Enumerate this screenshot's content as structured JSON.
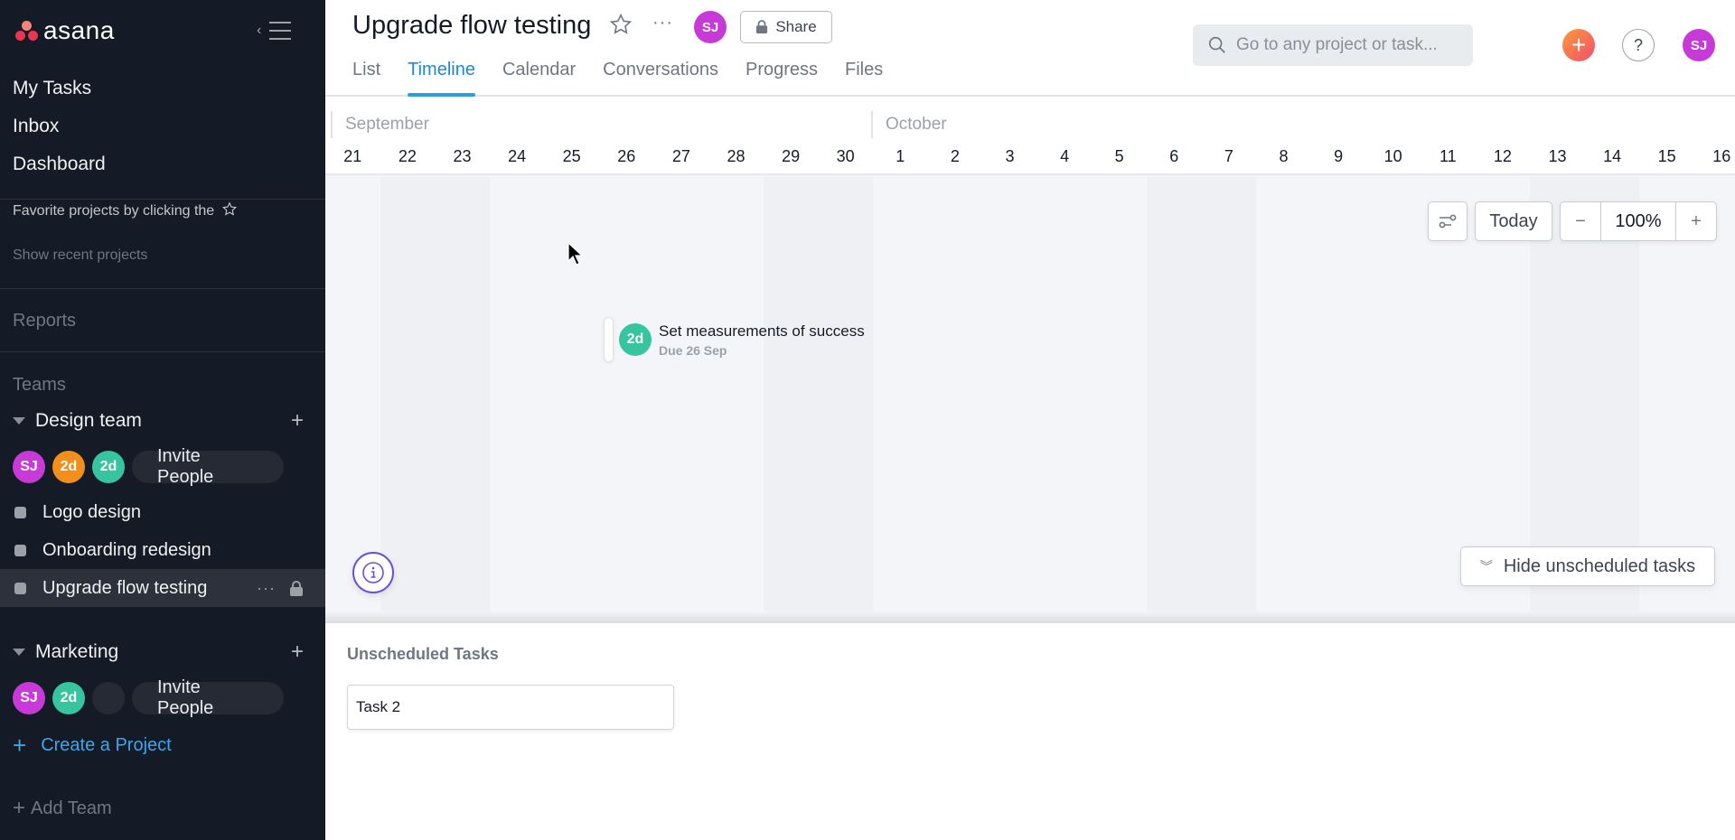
{
  "sidebar": {
    "logo": "asana",
    "nav": [
      "My Tasks",
      "Inbox",
      "Dashboard"
    ],
    "favorites_hint": "Favorite projects by clicking the",
    "show_recent": "Show recent projects",
    "reports": "Reports",
    "teams_label": "Teams",
    "teams": [
      {
        "name": "Design team",
        "members": [
          {
            "initials": "SJ",
            "color": "#c73ad8"
          },
          {
            "initials": "2d",
            "color": "#f28f1c"
          },
          {
            "initials": "2d",
            "color": "#37c5a0"
          }
        ],
        "invite_label": "Invite People",
        "projects": [
          {
            "name": "Logo design"
          },
          {
            "name": "Onboarding redesign"
          },
          {
            "name": "Upgrade flow testing",
            "active": true
          }
        ]
      },
      {
        "name": "Marketing",
        "members": [
          {
            "initials": "SJ",
            "color": "#c73ad8"
          },
          {
            "initials": "2d",
            "color": "#37c5a0"
          },
          {
            "initials": "",
            "color": "#252a35"
          }
        ],
        "invite_label": "Invite People",
        "projects": []
      }
    ],
    "create_project": "Create a Project",
    "add_team": "Add Team"
  },
  "header": {
    "project_title": "Upgrade flow testing",
    "owner_initials": "SJ",
    "share_label": "Share",
    "tabs": [
      {
        "label": "List"
      },
      {
        "label": "Timeline",
        "active": true
      },
      {
        "label": "Calendar"
      },
      {
        "label": "Conversations"
      },
      {
        "label": "Progress"
      },
      {
        "label": "Files"
      }
    ],
    "search_placeholder": "Go to any project or task...",
    "help_label": "?",
    "user_initials": "SJ"
  },
  "timeline": {
    "months": [
      {
        "label": "September",
        "start_day_index": 0
      },
      {
        "label": "October",
        "start_day_index": 10
      }
    ],
    "days": [
      "21",
      "22",
      "23",
      "24",
      "25",
      "26",
      "27",
      "28",
      "29",
      "30",
      "1",
      "2",
      "3",
      "4",
      "5",
      "6",
      "7",
      "8",
      "9",
      "10",
      "11",
      "12",
      "13",
      "14",
      "15",
      "16"
    ],
    "weekend_day_indices": [
      1,
      2,
      8,
      9,
      15,
      16,
      22,
      23
    ],
    "controls": {
      "today_label": "Today",
      "zoom_level": "100%",
      "zoom_out": "−",
      "zoom_in": "+"
    },
    "tasks": [
      {
        "name": "Set measurements of success",
        "due": "Due 26 Sep",
        "assignee_initials": "2d",
        "assignee_color": "#37c5a0",
        "day_index": 5
      }
    ],
    "hide_unscheduled_label": "Hide unscheduled tasks"
  },
  "unscheduled": {
    "title": "Unscheduled Tasks",
    "tasks": [
      "Task 2"
    ]
  }
}
